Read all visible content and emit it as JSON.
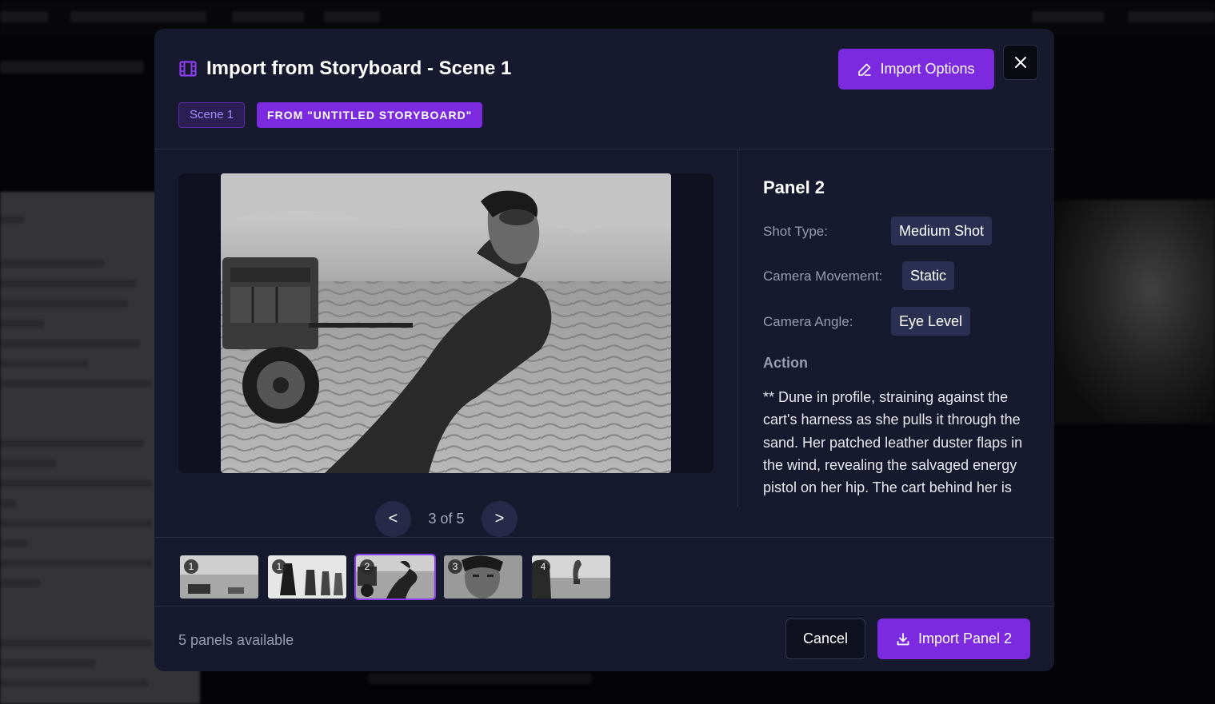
{
  "modal": {
    "title": "Import from Storyboard - Scene 1",
    "scene_badge": "Scene 1",
    "source_badge": "FROM \"UNTITLED STORYBOARD\"",
    "import_options_label": "Import Options",
    "icons": {
      "title": "film-icon",
      "import_options": "pencil-icon",
      "close": "close-icon",
      "import_panel": "download-icon"
    }
  },
  "preview": {
    "image_description": "Panel 2 storyboard image",
    "prev_label": "<",
    "next_label": ">",
    "counter": "3 of 5"
  },
  "details": {
    "panel_title": "Panel 2",
    "shot_type_label": "Shot Type:",
    "shot_type": "Medium Shot",
    "camera_movement_label": "Camera Movement:",
    "camera_movement": "Static",
    "camera_angle_label": "Camera Angle:",
    "camera_angle": "Eye Level",
    "action_heading": "Action",
    "action_text": "** Dune in profile, straining against the cart's harness as she pulls it through the sand. Her patched leather duster flaps in the wind, revealing the salvaged energy pistol on her hip. The cart behind her is"
  },
  "thumbnails": [
    {
      "number": "1",
      "active": false
    },
    {
      "number": "1",
      "active": false
    },
    {
      "number": "2",
      "active": true
    },
    {
      "number": "3",
      "active": false
    },
    {
      "number": "4",
      "active": false
    }
  ],
  "footer": {
    "status": "5 panels available",
    "cancel_label": "Cancel",
    "import_panel_label": "Import Panel 2"
  },
  "colors": {
    "accent": "#7c2ae0",
    "modal_bg": "#171a2e",
    "chip_bg": "#2b2f52"
  }
}
